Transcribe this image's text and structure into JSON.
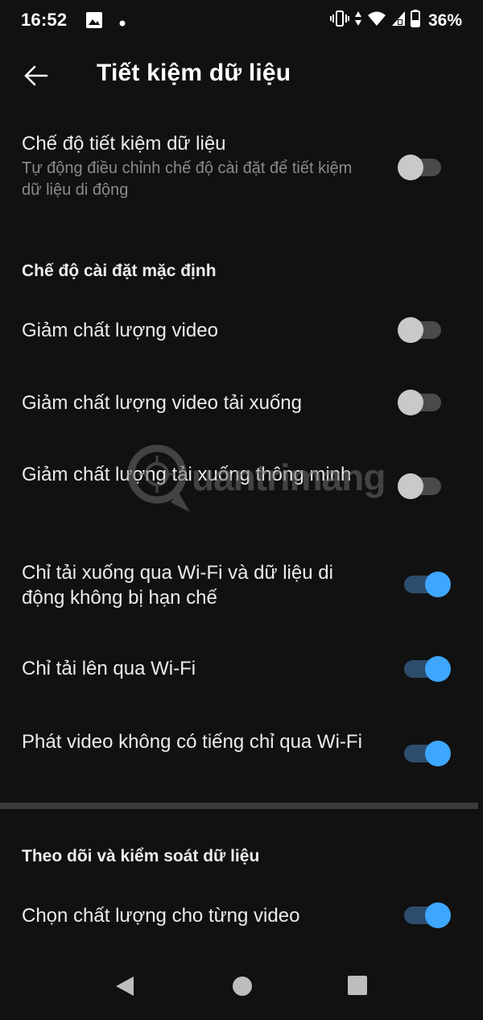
{
  "status_bar": {
    "time": "16:52",
    "battery": "36%",
    "icons": [
      "image-icon",
      "dot-icon",
      "vibrate-icon",
      "data-arrows-icon",
      "wifi-icon",
      "signal-icon",
      "battery-icon"
    ]
  },
  "app_bar": {
    "title": "Tiết kiệm dữ liệu",
    "back_icon": "arrow-left-icon"
  },
  "saver": {
    "label": "Chế độ tiết kiệm dữ liệu",
    "description": "Tự động điều chỉnh chế độ cài đặt để tiết kiệm dữ liệu di động",
    "enabled": false
  },
  "default_section": {
    "header": "Chế độ cài đặt mặc định",
    "items": [
      {
        "label": "Giảm chất lượng video",
        "enabled": false
      },
      {
        "label": "Giảm chất lượng video tải xuống",
        "enabled": false
      },
      {
        "label": "Giảm chất lượng tải xuống thông minh",
        "enabled": false
      },
      {
        "label": "Chỉ tải xuống qua Wi-Fi và dữ liệu di động không bị hạn chế",
        "enabled": true
      },
      {
        "label": "Chỉ tải lên qua Wi-Fi",
        "enabled": true
      },
      {
        "label": "Phát video không có tiếng chỉ qua Wi-Fi",
        "enabled": true
      }
    ]
  },
  "monitor_section": {
    "header": "Theo dõi và kiểm soát dữ liệu",
    "items": [
      {
        "label": "Chọn chất lượng cho từng video",
        "enabled": true
      }
    ]
  },
  "watermark": {
    "text": "uantrimang"
  },
  "colors": {
    "background": "#111111",
    "accent": "#3ea6ff",
    "track_on": "#2d4d6d",
    "thumb_off": "#c9c9c9",
    "track_off": "#4a4a4a",
    "secondary_text": "#8a8a8a"
  },
  "nav_bar": {
    "buttons": [
      "back-triangle-icon",
      "home-circle-icon",
      "recents-square-icon"
    ]
  }
}
